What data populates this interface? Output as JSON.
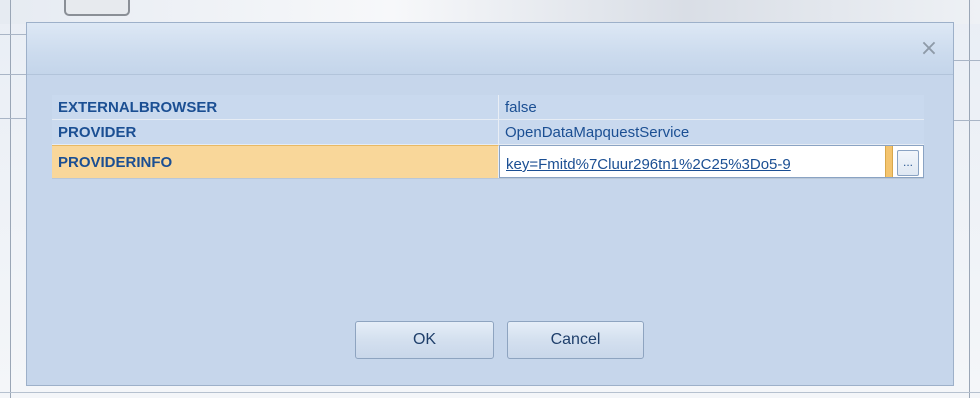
{
  "dialog": {
    "close_glyph": "×",
    "properties": [
      {
        "name": "EXTERNALBROWSER",
        "value": "false"
      },
      {
        "name": "PROVIDER",
        "value": "OpenDataMapquestService"
      },
      {
        "name": "PROVIDERINFO",
        "value": "key=Fmitd%7Cluur296tn1%2C25%3Do5-9"
      }
    ],
    "ellipsis_label": "...",
    "ok_label": "OK",
    "cancel_label": "Cancel"
  },
  "colors": {
    "selected_row": "#f9d79a",
    "label_text": "#1b4f93",
    "dialog_bg": "#c6d6eb"
  }
}
